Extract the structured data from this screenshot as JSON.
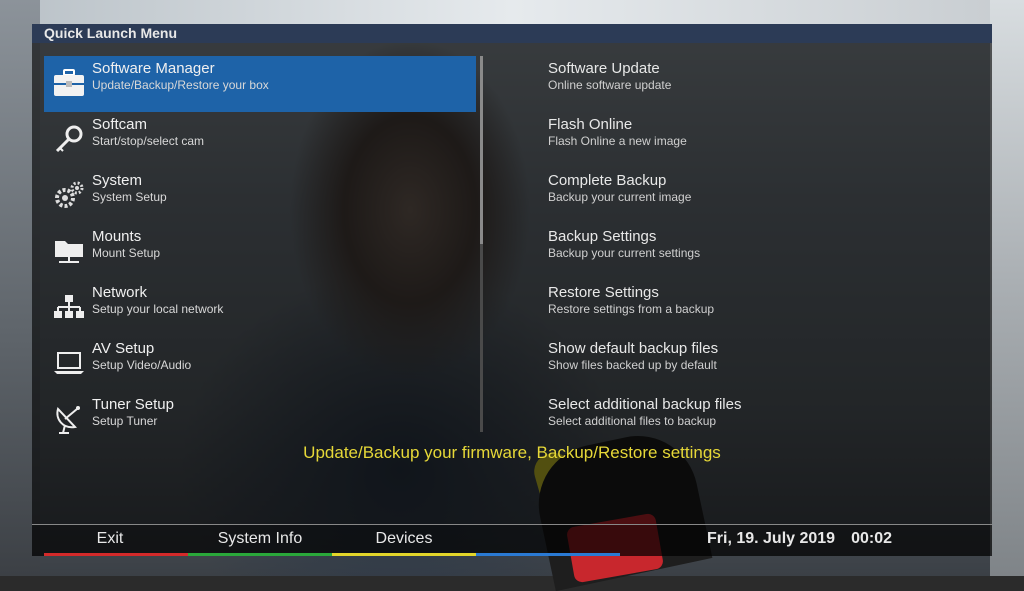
{
  "window": {
    "title": "Quick Launch Menu"
  },
  "menu": {
    "items": [
      {
        "title": "Software Manager",
        "subtitle": "Update/Backup/Restore your box",
        "icon": "toolbox-icon",
        "selected": true
      },
      {
        "title": "Softcam",
        "subtitle": "Start/stop/select cam",
        "icon": "key-icon"
      },
      {
        "title": "System",
        "subtitle": "System Setup",
        "icon": "gears-icon"
      },
      {
        "title": "Mounts",
        "subtitle": "Mount Setup",
        "icon": "network-folder-icon"
      },
      {
        "title": "Network",
        "subtitle": "Setup your local network",
        "icon": "network-icon"
      },
      {
        "title": "AV Setup",
        "subtitle": "Setup Video/Audio",
        "icon": "laptop-icon"
      },
      {
        "title": "Tuner Setup",
        "subtitle": "Setup Tuner",
        "icon": "satellite-dish-icon"
      }
    ]
  },
  "submenu": {
    "items": [
      {
        "title": "Software Update",
        "subtitle": "Online software update"
      },
      {
        "title": "Flash Online",
        "subtitle": "Flash Online a new image"
      },
      {
        "title": "Complete Backup",
        "subtitle": "Backup your current image"
      },
      {
        "title": "Backup Settings",
        "subtitle": "Backup your current settings"
      },
      {
        "title": "Restore Settings",
        "subtitle": "Restore settings from a backup"
      },
      {
        "title": "Show default backup files",
        "subtitle": "Show files backed up by default"
      },
      {
        "title": "Select additional backup files",
        "subtitle": "Select additional files to backup"
      }
    ]
  },
  "description": "Update/Backup your firmware, Backup/Restore settings",
  "footer": {
    "buttons": [
      {
        "label": "Exit",
        "color": "#d42a2a"
      },
      {
        "label": "System Info",
        "color": "#2aa83a"
      },
      {
        "label": "Devices",
        "color": "#e2d52a"
      },
      {
        "label": "",
        "color": "#2a7ad4"
      }
    ],
    "date": "Fri, 19. July 2019",
    "time": "00:02"
  },
  "colors": {
    "selection": "#1e63a8",
    "titlebar": "#2c3b56",
    "description_text": "#e6d838"
  }
}
